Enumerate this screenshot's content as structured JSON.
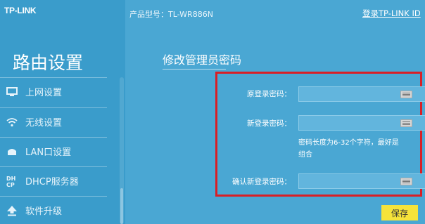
{
  "brand": {
    "logo": "TP-LINK"
  },
  "sidebar": {
    "title": "路由设置",
    "items": [
      {
        "label": "上网设置",
        "icon": "monitor-icon"
      },
      {
        "label": "无线设置",
        "icon": "wifi-icon"
      },
      {
        "label": "LAN口设置",
        "icon": "lan-icon"
      },
      {
        "label": "DHCP服务器",
        "icon": "dhcp-icon"
      },
      {
        "label": "软件升级",
        "icon": "upgrade-icon"
      }
    ]
  },
  "header": {
    "model": "产品型号：TL-WR886N",
    "login_link": "登录TP-LINK ID"
  },
  "main": {
    "section_title": "修改管理员密码",
    "fields": {
      "old_password_label": "原登录密码：",
      "new_password_label": "新登录密码：",
      "confirm_password_label": "确认新登录密码："
    },
    "hint_line1": "密码长度为6-32个字符，最好是",
    "hint_line2": "组合",
    "save_label": "保存"
  },
  "colors": {
    "background": "#4aa7d3",
    "highlight_border": "#d81f26",
    "save_button": "#f6e33a"
  }
}
